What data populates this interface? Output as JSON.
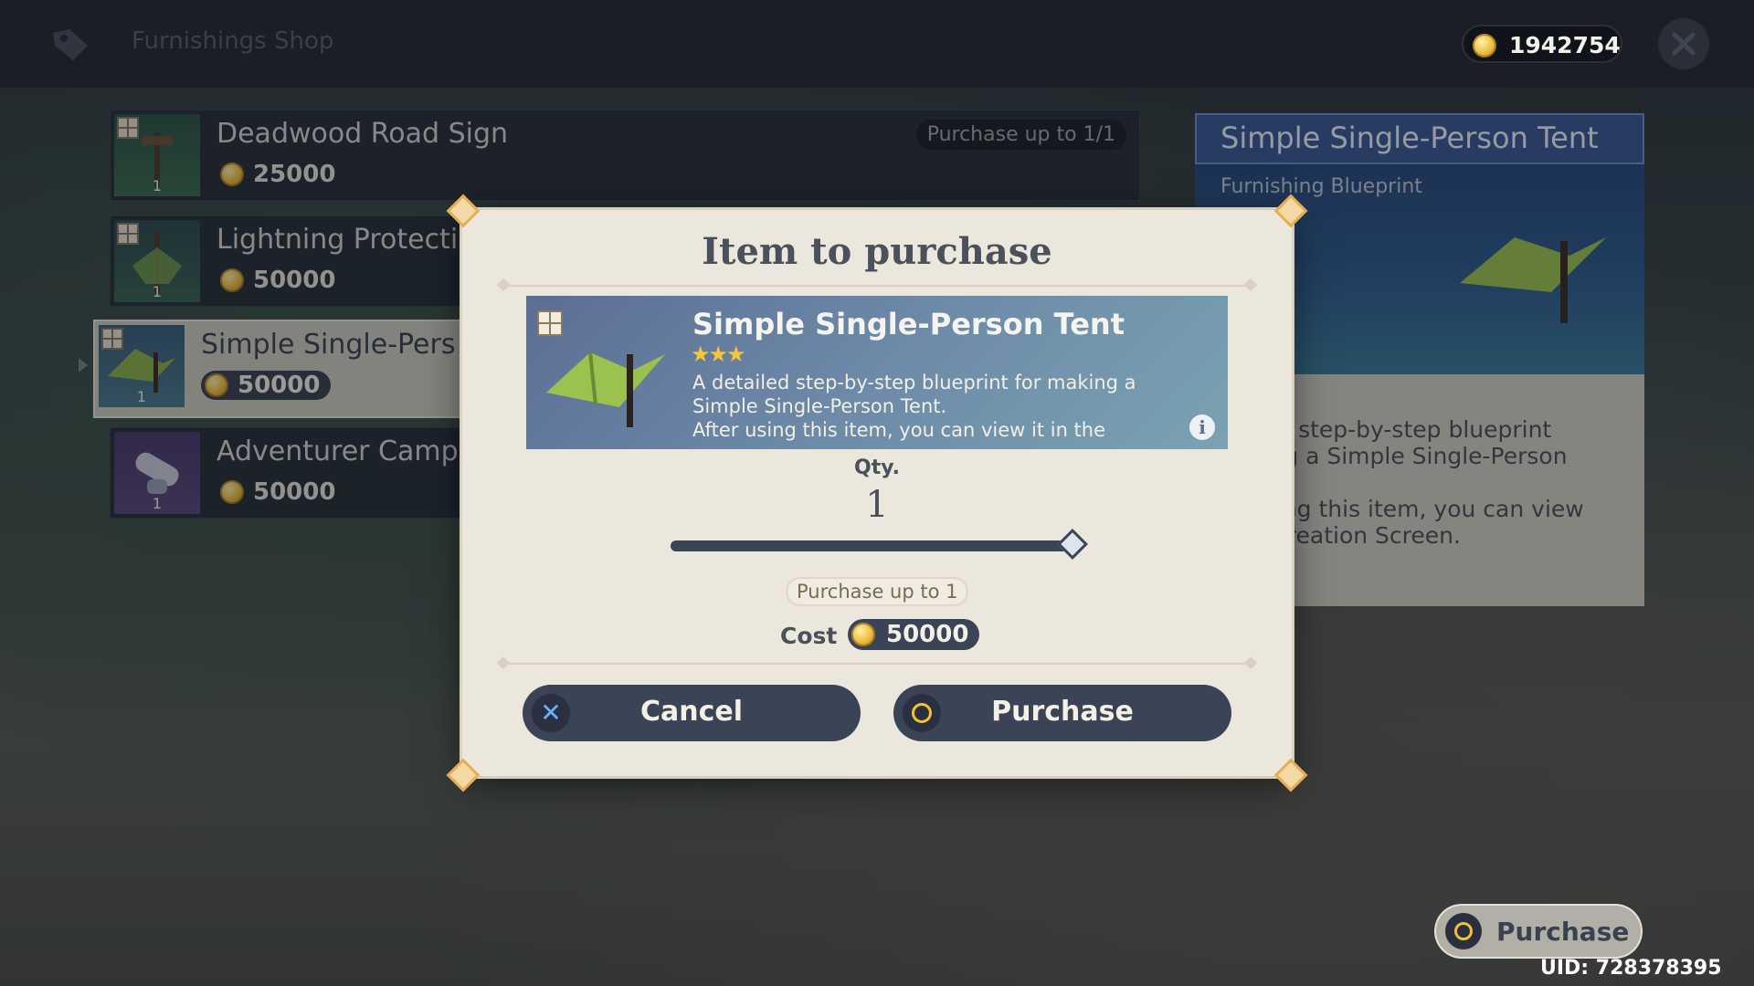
{
  "header": {
    "shop_title": "Furnishings Shop",
    "currency_amount": "1942754"
  },
  "items": [
    {
      "name": "Deadwood Road Sign",
      "price": "25000",
      "qty": "1",
      "limit": "Purchase up to 1/1"
    },
    {
      "name": "Lightning Protectio",
      "price": "50000",
      "qty": "1"
    },
    {
      "name": "Simple Single-Pers",
      "price": "50000",
      "qty": "1"
    },
    {
      "name": "Adventurer Camp",
      "price": "50000",
      "qty": "1"
    }
  ],
  "detail": {
    "title": "Simple Single-Person Tent",
    "type": "Furnishing Blueprint",
    "desc_line1": "iled step-by-step blueprint",
    "desc_line2": "king a Simple Single-Person",
    "desc_line3": "using this item, you can view",
    "desc_line4": "e Creation Screen."
  },
  "modal": {
    "title": "Item to purchase",
    "item_name": "Simple Single-Person Tent",
    "stars": "★★★",
    "rarity": 3,
    "desc_line1": "A detailed step-by-step blueprint for making a",
    "desc_line2": "Simple Single-Person Tent.",
    "desc_line3": "After using this item, you can view it in the",
    "qty_label": "Qty.",
    "qty_value": "1",
    "slider_fraction": 1.0,
    "limit_note": "Purchase up to 1",
    "cost_label": "Cost",
    "cost_value": "50000",
    "cancel_label": "Cancel",
    "purchase_label": "Purchase"
  },
  "bottom": {
    "purchase_label": "Purchase",
    "uid": "UID: 728378395"
  },
  "colors": {
    "accent_gold": "#f2c233",
    "button_dark": "#3b4357",
    "detail_header": "#3a5a94",
    "cancel_glyph": "#6ab0ff"
  }
}
